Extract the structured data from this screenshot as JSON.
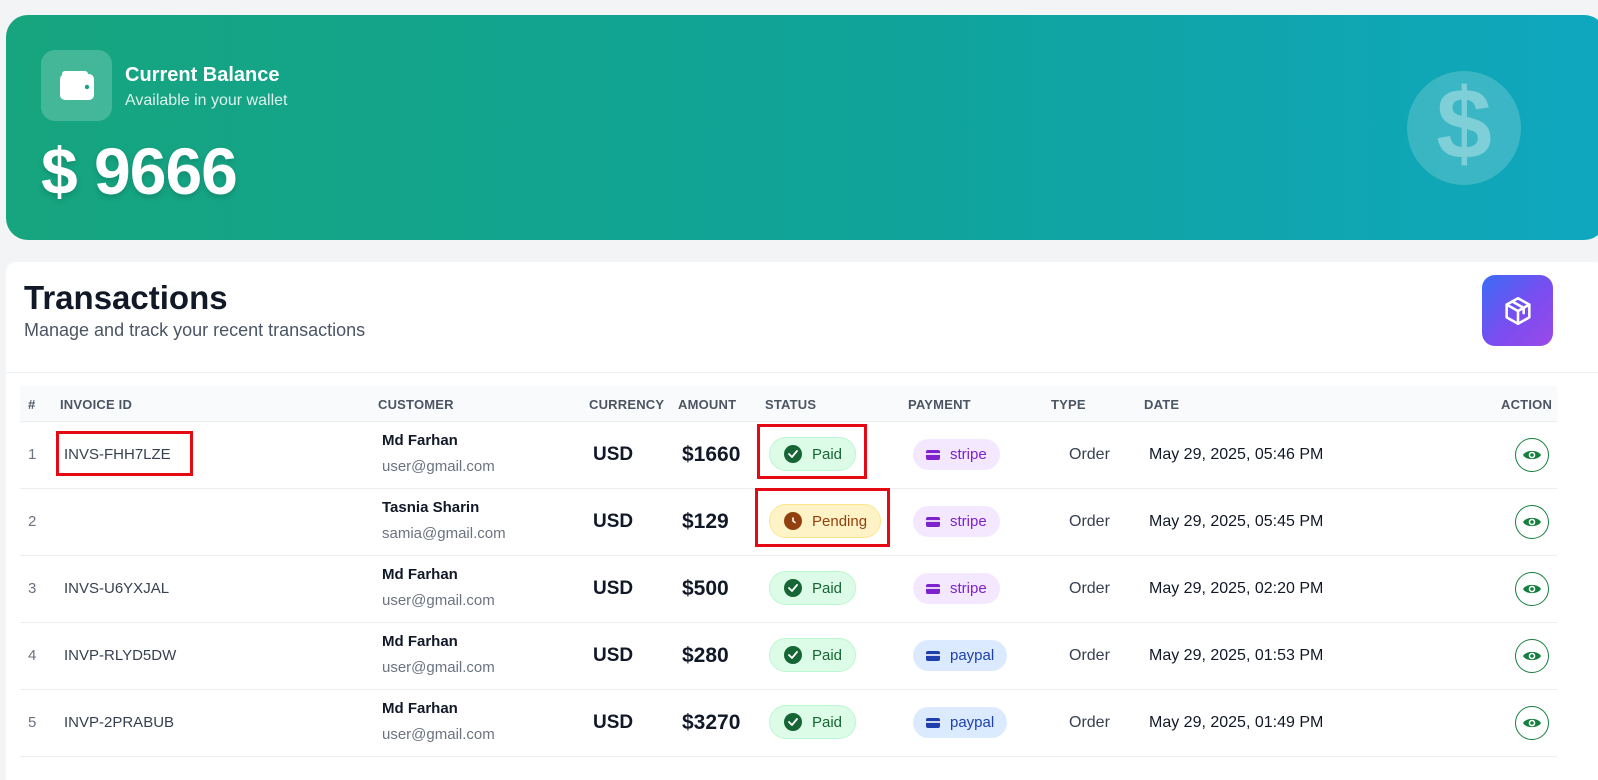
{
  "balance": {
    "title": "Current Balance",
    "subtitle": "Available in your wallet",
    "amount": "$ 9666",
    "wallet_icon": "wallet-icon",
    "decor_icon": "dollar-icon"
  },
  "transactions": {
    "title": "Transactions",
    "subtitle": "Manage and track your recent transactions",
    "action_icon": "box-icon",
    "columns": {
      "num": "#",
      "invoice": "INVOICE ID",
      "customer": "CUSTOMER",
      "currency": "CURRENCY",
      "amount": "AMOUNT",
      "status": "STATUS",
      "payment": "PAYMENT",
      "type": "TYPE",
      "date": "DATE",
      "action": "ACTION"
    },
    "rows": [
      {
        "num": "1",
        "invoice": "INVS-FHH7LZE",
        "name": "Md Farhan",
        "email": "user@gmail.com",
        "currency": "USD",
        "amount": "$1660",
        "status": "Paid",
        "payment": "stripe",
        "type": "Order",
        "date": "May 29, 2025, 05:46 PM"
      },
      {
        "num": "2",
        "invoice": "",
        "name": "Tasnia Sharin",
        "email": "samia@gmail.com",
        "currency": "USD",
        "amount": "$129",
        "status": "Pending",
        "payment": "stripe",
        "type": "Order",
        "date": "May 29, 2025, 05:45 PM"
      },
      {
        "num": "3",
        "invoice": "INVS-U6YXJAL",
        "name": "Md Farhan",
        "email": "user@gmail.com",
        "currency": "USD",
        "amount": "$500",
        "status": "Paid",
        "payment": "stripe",
        "type": "Order",
        "date": "May 29, 2025, 02:20 PM"
      },
      {
        "num": "4",
        "invoice": "INVP-RLYD5DW",
        "name": "Md Farhan",
        "email": "user@gmail.com",
        "currency": "USD",
        "amount": "$280",
        "status": "Paid",
        "payment": "paypal",
        "type": "Order",
        "date": "May 29, 2025, 01:53 PM"
      },
      {
        "num": "5",
        "invoice": "INVP-2PRABUB",
        "name": "Md Farhan",
        "email": "user@gmail.com",
        "currency": "USD",
        "amount": "$3270",
        "status": "Paid",
        "payment": "paypal",
        "type": "Order",
        "date": "May 29, 2025, 01:49 PM"
      }
    ]
  },
  "colors": {
    "gradient_start": "#16a57e",
    "gradient_end": "#0fa7bf",
    "paid": "#166534",
    "pending": "#92400e",
    "stripe": "#7e22ce",
    "paypal": "#1e40af",
    "highlight": "#e50914"
  }
}
